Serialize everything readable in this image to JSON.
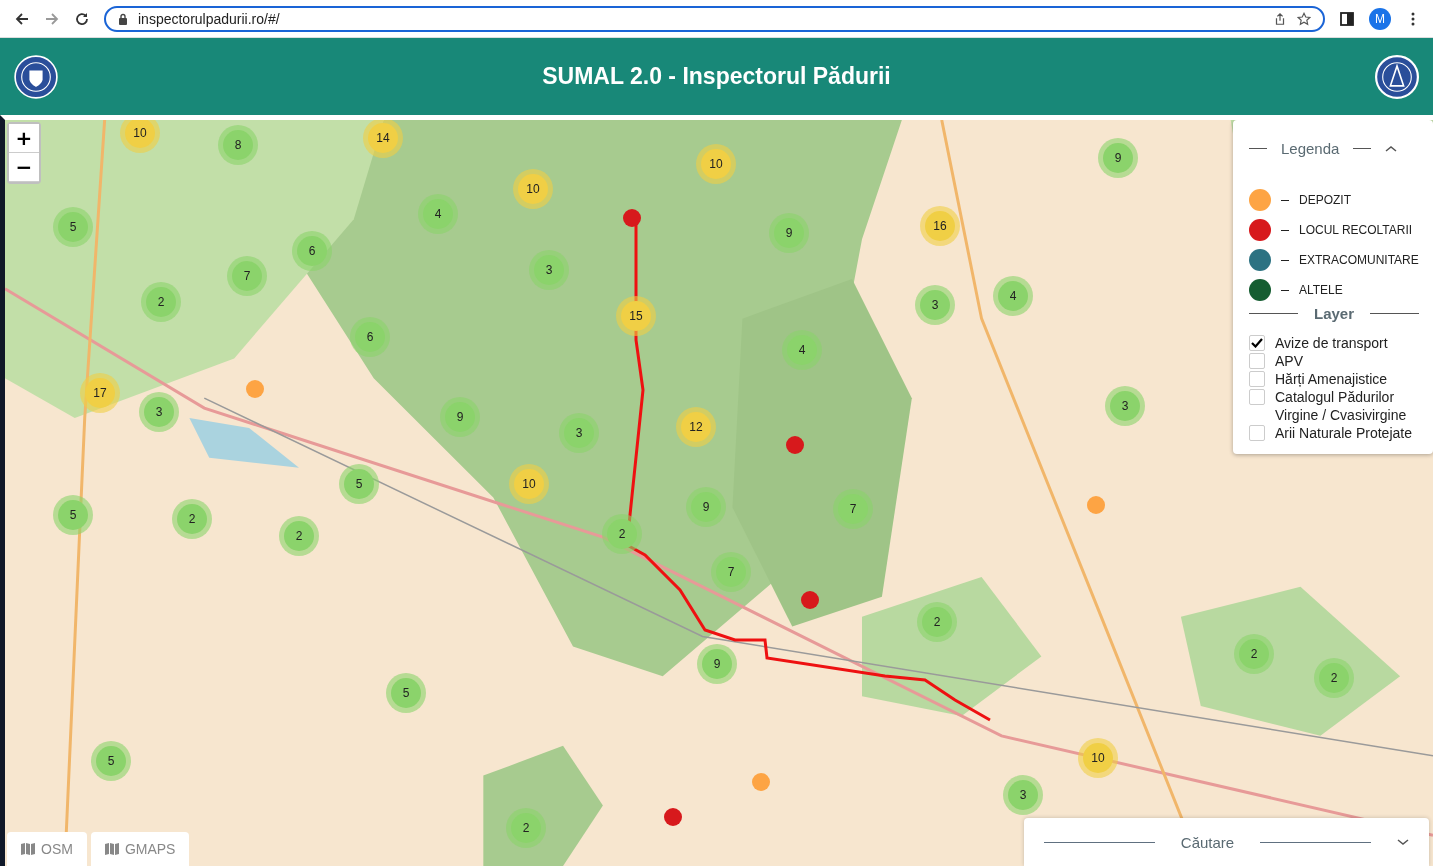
{
  "browser": {
    "url": "inspectorulpadurii.ro/#/",
    "profile": "M"
  },
  "header": {
    "title": "SUMAL 2.0 - Inspectorul Pădurii"
  },
  "map": {
    "zoom_controls": [
      "+",
      "−"
    ],
    "markers": [
      {
        "kind": "cluster",
        "color": "#f0cf45",
        "count": "10"
      },
      {
        "kind": "cluster",
        "color": "#8bd36b",
        "count": "8"
      },
      {
        "kind": "cluster",
        "color": "#f0cf45",
        "count": "14"
      },
      {
        "kind": "cluster",
        "color": "#f0cf45",
        "count": "10"
      },
      {
        "kind": "cluster",
        "color": "#f0cf45",
        "count": "10"
      },
      {
        "kind": "cluster",
        "color": "#8bd36b",
        "count": "9"
      },
      {
        "kind": "cluster",
        "color": "#8bd36b",
        "count": "5"
      },
      {
        "kind": "cluster",
        "color": "#8bd36b",
        "count": "4"
      },
      {
        "kind": "cluster",
        "color": "#8bd36b",
        "count": "6"
      },
      {
        "kind": "cluster",
        "color": "#8bd36b",
        "count": "9"
      },
      {
        "kind": "cluster",
        "color": "#f0cf45",
        "count": "16"
      },
      {
        "kind": "cluster",
        "color": "#8bd36b",
        "count": "7"
      },
      {
        "kind": "cluster",
        "color": "#8bd36b",
        "count": "3"
      },
      {
        "kind": "cluster",
        "color": "#8bd36b",
        "count": "2"
      },
      {
        "kind": "cluster",
        "color": "#8bd36b",
        "count": "3"
      },
      {
        "kind": "cluster",
        "color": "#8bd36b",
        "count": "4"
      },
      {
        "kind": "cluster",
        "color": "#f0cf45",
        "count": "15"
      },
      {
        "kind": "cluster",
        "color": "#8bd36b",
        "count": "6"
      },
      {
        "kind": "cluster",
        "color": "#8bd36b",
        "count": "4"
      },
      {
        "kind": "cluster",
        "color": "#f0cf45",
        "count": "17"
      },
      {
        "kind": "cluster",
        "color": "#8bd36b",
        "count": "3"
      },
      {
        "kind": "cluster",
        "color": "#8bd36b",
        "count": "9"
      },
      {
        "kind": "cluster",
        "color": "#8bd36b",
        "count": "3"
      },
      {
        "kind": "cluster",
        "color": "#f0cf45",
        "count": "12"
      },
      {
        "kind": "cluster",
        "color": "#8bd36b",
        "count": "3"
      },
      {
        "kind": "cluster",
        "color": "#f0cf45",
        "count": "10"
      },
      {
        "kind": "cluster",
        "color": "#8bd36b",
        "count": "5"
      },
      {
        "kind": "cluster",
        "color": "#8bd36b",
        "count": "5"
      },
      {
        "kind": "cluster",
        "color": "#8bd36b",
        "count": "2"
      },
      {
        "kind": "cluster",
        "color": "#8bd36b",
        "count": "2"
      },
      {
        "kind": "cluster",
        "color": "#8bd36b",
        "count": "2"
      },
      {
        "kind": "cluster",
        "color": "#8bd36b",
        "count": "9"
      },
      {
        "kind": "cluster",
        "color": "#8bd36b",
        "count": "7"
      },
      {
        "kind": "cluster",
        "color": "#8bd36b",
        "count": "7"
      },
      {
        "kind": "cluster",
        "color": "#8bd36b",
        "count": "2"
      },
      {
        "kind": "cluster",
        "color": "#8bd36b",
        "count": "2"
      },
      {
        "kind": "cluster",
        "color": "#8bd36b",
        "count": "2"
      },
      {
        "kind": "cluster",
        "color": "#8bd36b",
        "count": "9"
      },
      {
        "kind": "cluster",
        "color": "#8bd36b",
        "count": "5"
      },
      {
        "kind": "cluster",
        "color": "#8bd36b",
        "count": "5"
      },
      {
        "kind": "cluster",
        "color": "#f0cf45",
        "count": "10"
      },
      {
        "kind": "cluster",
        "color": "#8bd36b",
        "count": "3"
      },
      {
        "kind": "cluster",
        "color": "#8bd36b",
        "count": "2"
      },
      {
        "kind": "point",
        "color": "#d7191c"
      },
      {
        "kind": "point",
        "color": "#d7191c"
      },
      {
        "kind": "point",
        "color": "#d7191c"
      },
      {
        "kind": "point",
        "color": "#d7191c"
      },
      {
        "kind": "point",
        "color": "#fda444"
      },
      {
        "kind": "point",
        "color": "#fda444"
      },
      {
        "kind": "point",
        "color": "#fda444"
      }
    ],
    "base_layers": [
      {
        "label": "OSM"
      },
      {
        "label": "GMAPS"
      }
    ]
  },
  "legend": {
    "title": "Legenda",
    "expanded": true,
    "items": [
      {
        "label": "DEPOZIT",
        "color": "#fda444"
      },
      {
        "label": "LOCUL RECOLTARII",
        "color": "#d7191c"
      },
      {
        "label": "EXTRACOMUNITARE",
        "color": "#2c7282"
      },
      {
        "label": "ALTELE",
        "color": "#155d31"
      }
    ],
    "layer_title": "Layer",
    "layers": [
      {
        "label": "Avize de transport",
        "checked": true
      },
      {
        "label": "APV",
        "checked": false
      },
      {
        "label": "Hărți Amenajistice",
        "checked": false
      },
      {
        "label": "Catalogul Pădurilor Virgine / Cvasivirgine",
        "checked": false
      },
      {
        "label": "Arii Naturale Protejate",
        "checked": false
      }
    ]
  },
  "search": {
    "title": "Căutare",
    "expanded": false
  }
}
